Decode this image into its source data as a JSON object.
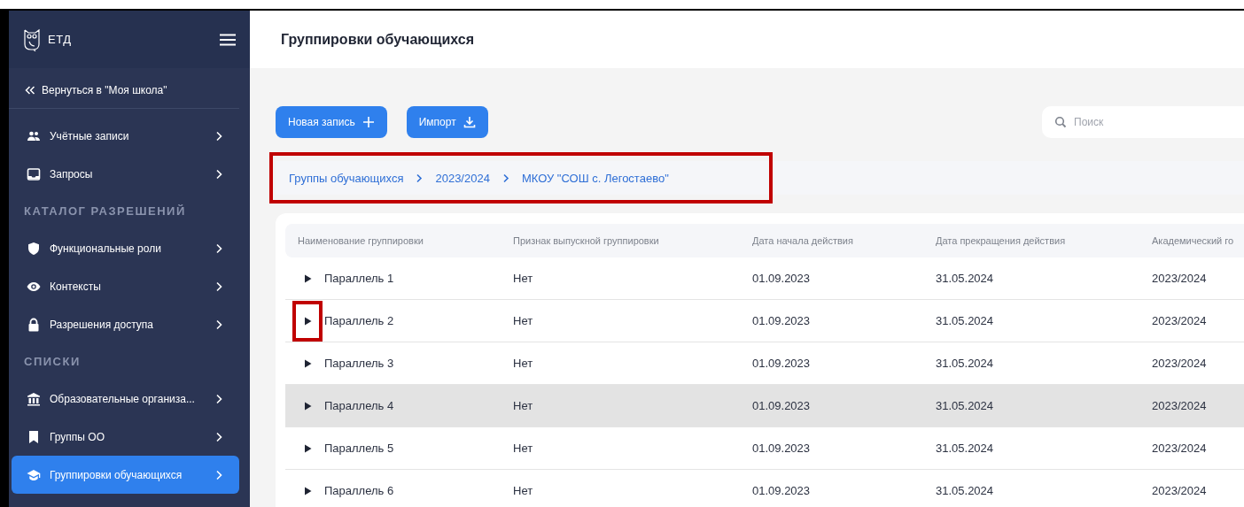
{
  "sidebar": {
    "logo_text": "ЕТД",
    "back_link": "Вернуться в \"Моя школа\"",
    "items": [
      {
        "kind": "item",
        "label": "Учётные записи",
        "selected": false
      },
      {
        "kind": "item",
        "label": "Запросы",
        "selected": false
      },
      {
        "kind": "section",
        "label": "КАТАЛОГ РАЗРЕШЕНИЙ"
      },
      {
        "kind": "item",
        "label": "Функциональные роли",
        "selected": false
      },
      {
        "kind": "item",
        "label": "Контексты",
        "selected": false
      },
      {
        "kind": "item",
        "label": "Разрешения доступа",
        "selected": false
      },
      {
        "kind": "section",
        "label": "СПИСКИ"
      },
      {
        "kind": "item",
        "label": "Образовательные организа...",
        "selected": false
      },
      {
        "kind": "item",
        "label": "Группы ОО",
        "selected": false
      },
      {
        "kind": "item",
        "label": "Группировки обучающихся",
        "selected": true
      }
    ]
  },
  "page_title": "Группировки обучающихся",
  "toolbar": {
    "buttons": [
      {
        "label": "Новая запись"
      },
      {
        "label": "Импорт"
      }
    ],
    "search": {
      "placeholder": "Поиск"
    }
  },
  "breadcrumb": {
    "highlighted": true,
    "items": [
      "Группы обучающихся",
      "2023/2024",
      "МКОУ \"СОШ с. Легостаево\""
    ]
  },
  "table": {
    "columns": [
      "Наименование группировки",
      "Признак выпускной группировки",
      "Дата начала действия",
      "Дата прекращения действия",
      "Академический го"
    ],
    "rows": [
      {
        "name": "Параллель 1",
        "graduate": "Нет",
        "start": "01.09.2023",
        "end": "31.05.2024",
        "year": "2023/2024",
        "hovered": false,
        "toggle_highlighted": false
      },
      {
        "name": "Параллель 2",
        "graduate": "Нет",
        "start": "01.09.2023",
        "end": "31.05.2024",
        "year": "2023/2024",
        "hovered": false,
        "toggle_highlighted": true
      },
      {
        "name": "Параллель 3",
        "graduate": "Нет",
        "start": "01.09.2023",
        "end": "31.05.2024",
        "year": "2023/2024",
        "hovered": false,
        "toggle_highlighted": false
      },
      {
        "name": "Параллель 4",
        "graduate": "Нет",
        "start": "01.09.2023",
        "end": "31.05.2024",
        "year": "2023/2024",
        "hovered": true,
        "toggle_highlighted": false
      },
      {
        "name": "Параллель 5",
        "graduate": "Нет",
        "start": "01.09.2023",
        "end": "31.05.2024",
        "year": "2023/2024",
        "hovered": false,
        "toggle_highlighted": false
      },
      {
        "name": "Параллель 6",
        "graduate": "Нет",
        "start": "01.09.2023",
        "end": "31.05.2024",
        "year": "2023/2024",
        "hovered": false,
        "toggle_highlighted": false
      }
    ]
  }
}
